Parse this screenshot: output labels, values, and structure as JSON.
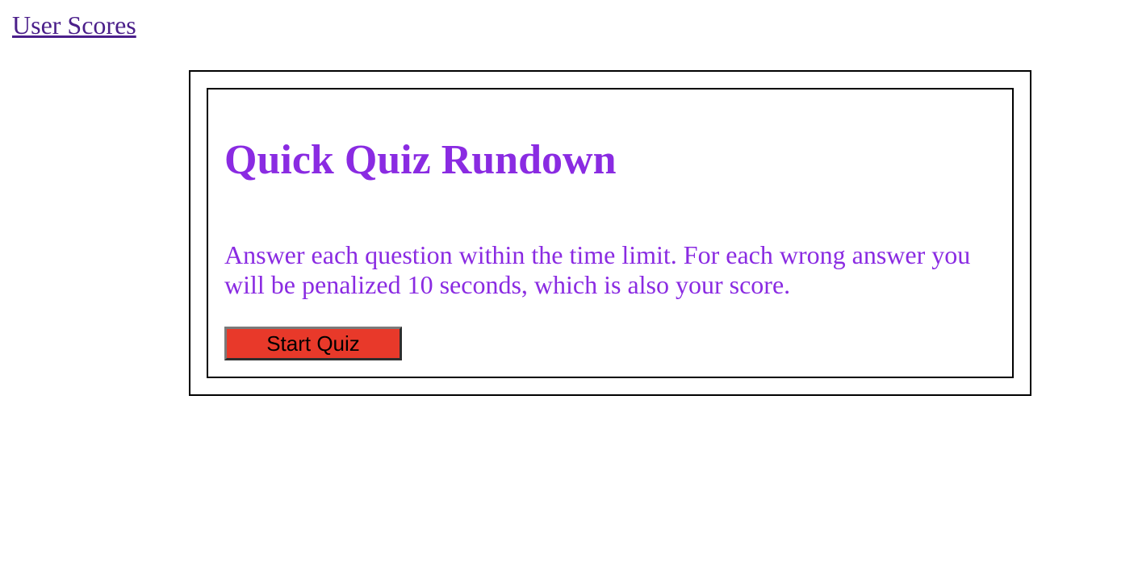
{
  "nav": {
    "scores_link": "User Scores"
  },
  "quiz": {
    "title": "Quick Quiz Rundown",
    "description": "Answer each question within the time limit. For each wrong answer you will be penalized 10 seconds, which is also your score.",
    "start_button": "Start Quiz"
  },
  "colors": {
    "link": "#4b1f8a",
    "accent_purple": "#8a2be2",
    "button_red": "#e8392a"
  }
}
